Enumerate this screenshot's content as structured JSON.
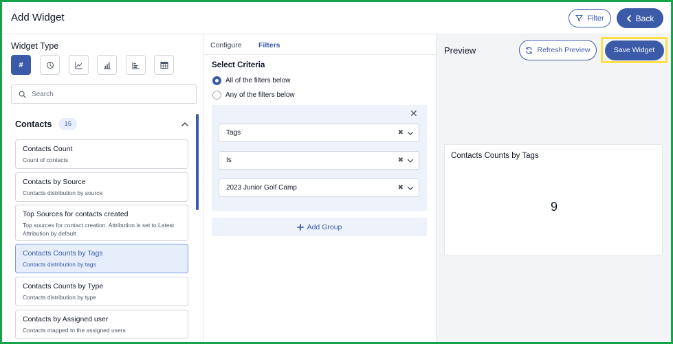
{
  "header": {
    "title": "Add Widget",
    "filter_label": "Filter",
    "back_label": "Back"
  },
  "left": {
    "section_title": "Widget Type",
    "widget_types": [
      {
        "name": "number-icon",
        "glyph": "#",
        "active": true
      },
      {
        "name": "pie-chart-icon"
      },
      {
        "name": "line-chart-icon"
      },
      {
        "name": "bar-chart-icon"
      },
      {
        "name": "horizontal-bar-icon"
      },
      {
        "name": "table-icon"
      }
    ],
    "search_placeholder": "Search",
    "category": {
      "label": "Contacts",
      "count": "15"
    },
    "cards": [
      {
        "title": "Contacts Count",
        "desc": "Count of contacts"
      },
      {
        "title": "Contacts by Source",
        "desc": "Contacts distribution by source"
      },
      {
        "title": "Top Sources for contacts created",
        "desc": "Top sources for contact creation. Attribution is set to Latest Attribution by default"
      },
      {
        "title": "Contacts Counts by Tags",
        "desc": "Contacts distribution by tags",
        "selected": true
      },
      {
        "title": "Contacts Counts by Type",
        "desc": "Contacts distribution by type"
      },
      {
        "title": "Contacts by Assigned user",
        "desc": "Contacts mapped to the assigned users"
      }
    ]
  },
  "middle": {
    "tabs": [
      {
        "label": "Configure",
        "active": false
      },
      {
        "label": "Filters",
        "active": true
      }
    ],
    "criteria_title": "Select Criteria",
    "radios": [
      {
        "label": "All of the filters below",
        "checked": true
      },
      {
        "label": "Any of the filters below",
        "checked": false
      }
    ],
    "filters": [
      {
        "value": "Tags"
      },
      {
        "value": "Is"
      },
      {
        "value": "2023 Junior Golf Camp"
      }
    ],
    "add_group_label": "Add Group"
  },
  "right": {
    "title": "Preview",
    "refresh_label": "Refresh Preview",
    "save_label": "Save Widget",
    "preview_card": {
      "title": "Contacts Counts by Tags",
      "value": "9"
    }
  },
  "colors": {
    "accent": "#3b5ba9",
    "frame": "#16a34a",
    "highlight": "#fde047"
  }
}
